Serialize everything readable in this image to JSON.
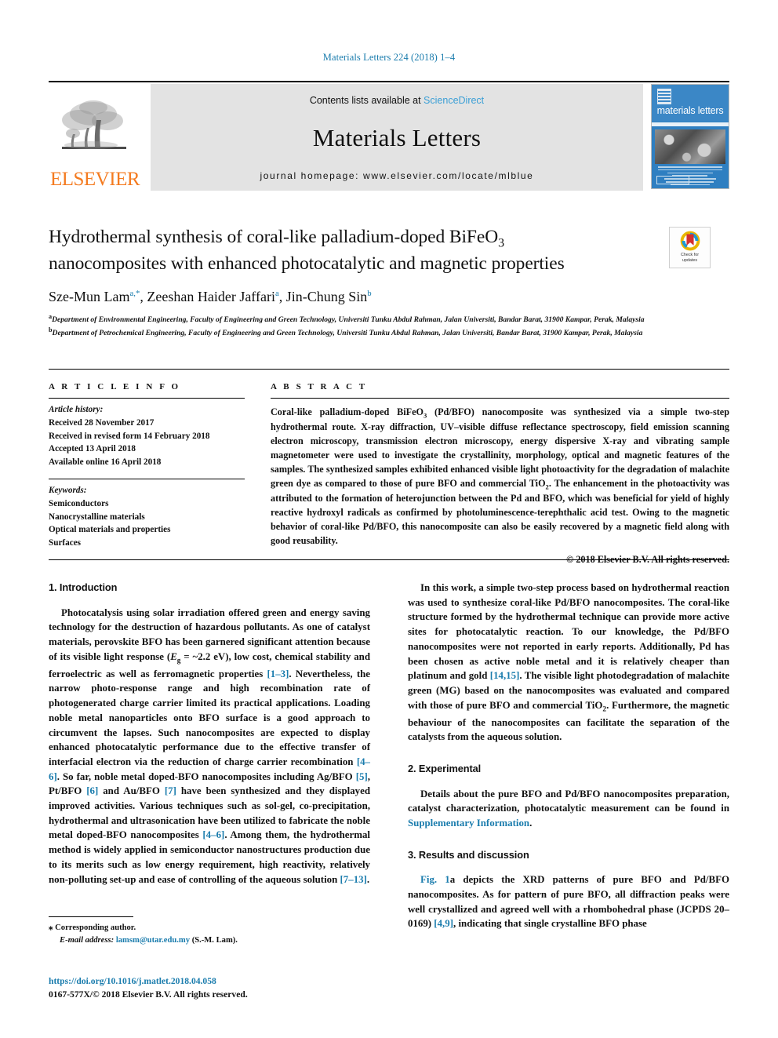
{
  "running_head": "Materials Letters 224 (2018) 1–4",
  "masthead": {
    "publisher_name": "ELSEVIER",
    "contents_prefix": "Contents lists available at ",
    "contents_link": "ScienceDirect",
    "journal_name": "Materials Letters",
    "homepage": "journal homepage: www.elsevier.com/locate/mlblue",
    "cover_title": "materials letters",
    "link_color": "#3a9fd6",
    "elsevier_orange": "#F47B20"
  },
  "article": {
    "title_line1": "Hydrothermal synthesis of coral-like palladium-doped BiFeO",
    "title_sub": "3",
    "title_line2": "nanocomposites with enhanced photocatalytic and magnetic properties",
    "crossmark_label_line1": "Check for",
    "crossmark_label_line2": "updates",
    "authors": "Sze-Mun Lam, Zeeshan Haider Jaffari, Jin-Chung Sin",
    "author_marks": [
      "a,*",
      "a",
      "b"
    ],
    "affiliation_a": "Department of Environmental Engineering, Faculty of Engineering and Green Technology, Universiti Tunku Abdul Rahman, Jalan Universiti, Bandar Barat, 31900 Kampar, Perak, Malaysia",
    "affiliation_b": "Department of Petrochemical Engineering, Faculty of Engineering and Green Technology, Universiti Tunku Abdul Rahman, Jalan Universiti, Bandar Barat, 31900 Kampar, Perak, Malaysia"
  },
  "sections": {
    "article_info_heading": "A R T I C L E  I N F O",
    "abstract_heading": "A B S T R A C T"
  },
  "article_info": {
    "history_label": "Article history:",
    "history": [
      "Received 28 November 2017",
      "Received in revised form 14 February 2018",
      "Accepted 13 April 2018",
      "Available online 16 April 2018"
    ],
    "keywords_label": "Keywords:",
    "keywords": [
      "Semiconductors",
      "Nanocrystalline materials",
      "Optical materials and properties",
      "Surfaces"
    ]
  },
  "abstract": {
    "text_part1": "Coral-like palladium-doped BiFeO",
    "text_sub1": "3",
    "text_part2": " (Pd/BFO) nanocomposite was synthesized via a simple two-step hydrothermal route. X-ray diffraction, UV–visible diffuse reflectance spectroscopy, field emission scanning electron microscopy, transmission electron microscopy, energy dispersive X-ray and vibrating sample magnetometer were used to investigate the crystallinity, morphology, optical and magnetic features of the samples. The synthesized samples exhibited enhanced visible light photoactivity for the degradation of malachite green dye as compared to those of pure BFO and commercial TiO",
    "text_sub2": "2",
    "text_part3": ". The enhancement in the photoactivity was attributed to the formation of heterojunction between the Pd and BFO, which was beneficial for yield of highly reactive hydroxyl radicals as confirmed by photoluminescence-terephthalic acid test. Owing to the magnetic behavior of coral-like Pd/BFO, this nanocomposite can also be easily recovered by a magnetic field along with good reusability.",
    "copyright": "© 2018 Elsevier B.V. All rights reserved."
  },
  "body": {
    "intro_heading": "1. Introduction",
    "intro_p1_a": "Photocatalysis using solar irradiation offered green and energy saving technology for the destruction of hazardous pollutants. As one of catalyst materials, perovskite BFO has been garnered significant attention because of its visible light response (",
    "intro_p1_eg": "E",
    "intro_p1_eg_sub": "g",
    "intro_p1_b": " = ~2.2 eV), low cost, chemical stability and ferroelectric as well as ferromagnetic properties ",
    "ref_1_3": "[1–3]",
    "intro_p1_c": ". Nevertheless, the narrow photo-response range and high recombination rate of photogenerated charge carrier limited its practical applications. Loading noble metal nanoparticles onto BFO surface is a good approach to circumvent the lapses. Such nanocomposites are expected to display enhanced photocatalytic performance due to the effective transfer of interfacial electron via the reduction of charge carrier recombination ",
    "ref_4_6": "[4–6]",
    "intro_p1_d": ". So far, noble metal doped-BFO nanocomposites including Ag/BFO ",
    "ref_5": "[5]",
    "intro_p1_e": ", Pt/BFO ",
    "ref_6": "[6]",
    "intro_p1_f": " and Au/BFO ",
    "ref_7": "[7]",
    "intro_p1_g": " have been synthesized and they displayed improved activities. Various techniques such as sol-gel, co-precipitation, hydrothermal and ultrasonication have been utilized to fabricate the noble metal doped-BFO nanocomposites ",
    "ref_4_6b": "[4–6]",
    "intro_p1_h": ". Among them, the hydrothermal method is widely applied in semiconductor nanostructures production due to its merits such as low energy requirement, high reactivity, relatively non-polluting set-up and ease of controlling of the aqueous solution ",
    "ref_7_13": "[7–13]",
    "intro_p1_i": ".",
    "right_p1_a": "In this work, a simple two-step process based on hydrothermal reaction was used to synthesize coral-like Pd/BFO nanocomposites. The coral-like structure formed by the hydrothermal technique can provide more active sites for photocatalytic reaction. To our knowledge, the Pd/BFO nanocomposites were not reported in early reports. Additionally, Pd has been chosen as active noble metal and it is relatively cheaper than platinum and gold ",
    "ref_14_15": "[14,15]",
    "right_p1_b": ". The visible light photodegradation of malachite green (MG) based on the nanocomposites was evaluated and compared with those of pure BFO and commercial TiO",
    "right_p1_sub": "2",
    "right_p1_c": ". Furthermore, the magnetic behaviour of the nanocomposites can facilitate the separation of the catalysts from the aqueous solution.",
    "experimental_heading": "2. Experimental",
    "exp_p1_a": "Details about the pure BFO and Pd/BFO nanocomposites preparation, catalyst characterization, photocatalytic measurement can be found in ",
    "exp_link": "Supplementary Information",
    "exp_p1_b": ".",
    "results_heading": "3. Results and discussion",
    "res_link": "Fig. 1",
    "res_p1_a": "a depicts the XRD patterns of pure BFO and Pd/BFO nanocomposites. As for pattern of pure BFO, all diffraction peaks were well crystallized and agreed well with a rhombohedral phase (JCPDS 20–0169) ",
    "ref_4_9": "[4,9]",
    "res_p1_b": ", indicating that single crystalline BFO phase"
  },
  "footnotes": {
    "corresponding": "Corresponding author.",
    "email_label": "E-mail address:",
    "email": "lamsm@utar.edu.my",
    "email_owner": "(S.-M. Lam).",
    "doi": "https://doi.org/10.1016/j.matlet.2018.04.058",
    "issn_line": "0167-577X/© 2018 Elsevier B.V. All rights reserved."
  }
}
